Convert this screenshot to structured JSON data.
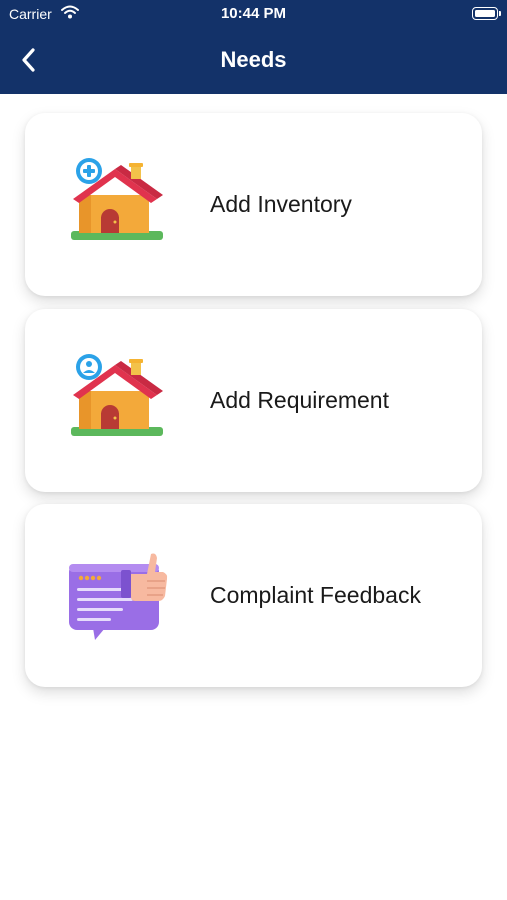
{
  "status_bar": {
    "carrier": "Carrier",
    "time": "10:44 PM"
  },
  "header": {
    "title": "Needs",
    "back_icon": "chevron-left-icon"
  },
  "colors": {
    "header_bg": "#133269",
    "card_bg": "#ffffff",
    "house_roof": "#e0334e",
    "house_wall": "#f3a93a",
    "feedback_purple": "#9a6ee6"
  },
  "menu": [
    {
      "label": "Add Inventory",
      "icon": "house-plus-icon"
    },
    {
      "label": "Add Requirement",
      "icon": "house-user-icon"
    },
    {
      "label": "Complaint Feedback",
      "icon": "feedback-thumbs-up-icon"
    }
  ]
}
